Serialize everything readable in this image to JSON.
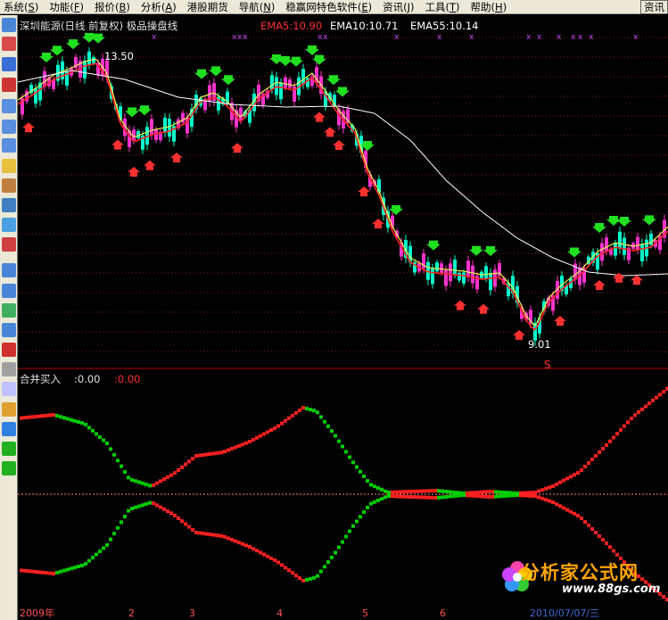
{
  "menu": [
    {
      "label": "系统",
      "key": "S"
    },
    {
      "label": "功能",
      "key": "F"
    },
    {
      "label": "报价",
      "key": "B"
    },
    {
      "label": "分析",
      "key": "A"
    },
    {
      "label": "港股期货",
      "key": ""
    },
    {
      "label": "导航",
      "key": "N"
    },
    {
      "label": "稳赢网特色软件",
      "key": "E"
    },
    {
      "label": "资讯",
      "key": "J"
    },
    {
      "label": "工具",
      "key": "T"
    },
    {
      "label": "帮助",
      "key": "H"
    }
  ],
  "menu_right": "资讯",
  "chart": {
    "title": "深圳能源(日线 前复权) 极品操盘线",
    "ema5": "EMA5:10.90",
    "ema10": "EMA10:10.71",
    "ema55": "EMA55:10.14",
    "high_label": "13.50",
    "low_label": "9.01",
    "sub_title": "合并买入",
    "sub_value1": ":0.00",
    "sub_value2": ":0.00",
    "signal_mark": "S",
    "x_ticks": [
      {
        "label": "2009年"
      },
      {
        "label": "2"
      },
      {
        "label": "3"
      },
      {
        "label": "4"
      },
      {
        "label": "5"
      },
      {
        "label": "6"
      }
    ],
    "date_box": "2010/07/07/三",
    "colors": {
      "up": "#ff33cc",
      "down": "#00ffcc",
      "ema5": "#ff2020",
      "ema10": "#ffff40",
      "ema55": "#ffffff",
      "green": "#00cc00",
      "red": "#ff2020"
    }
  },
  "watermark": {
    "text": "分析家公式网",
    "url": "www.88gs.com"
  }
}
